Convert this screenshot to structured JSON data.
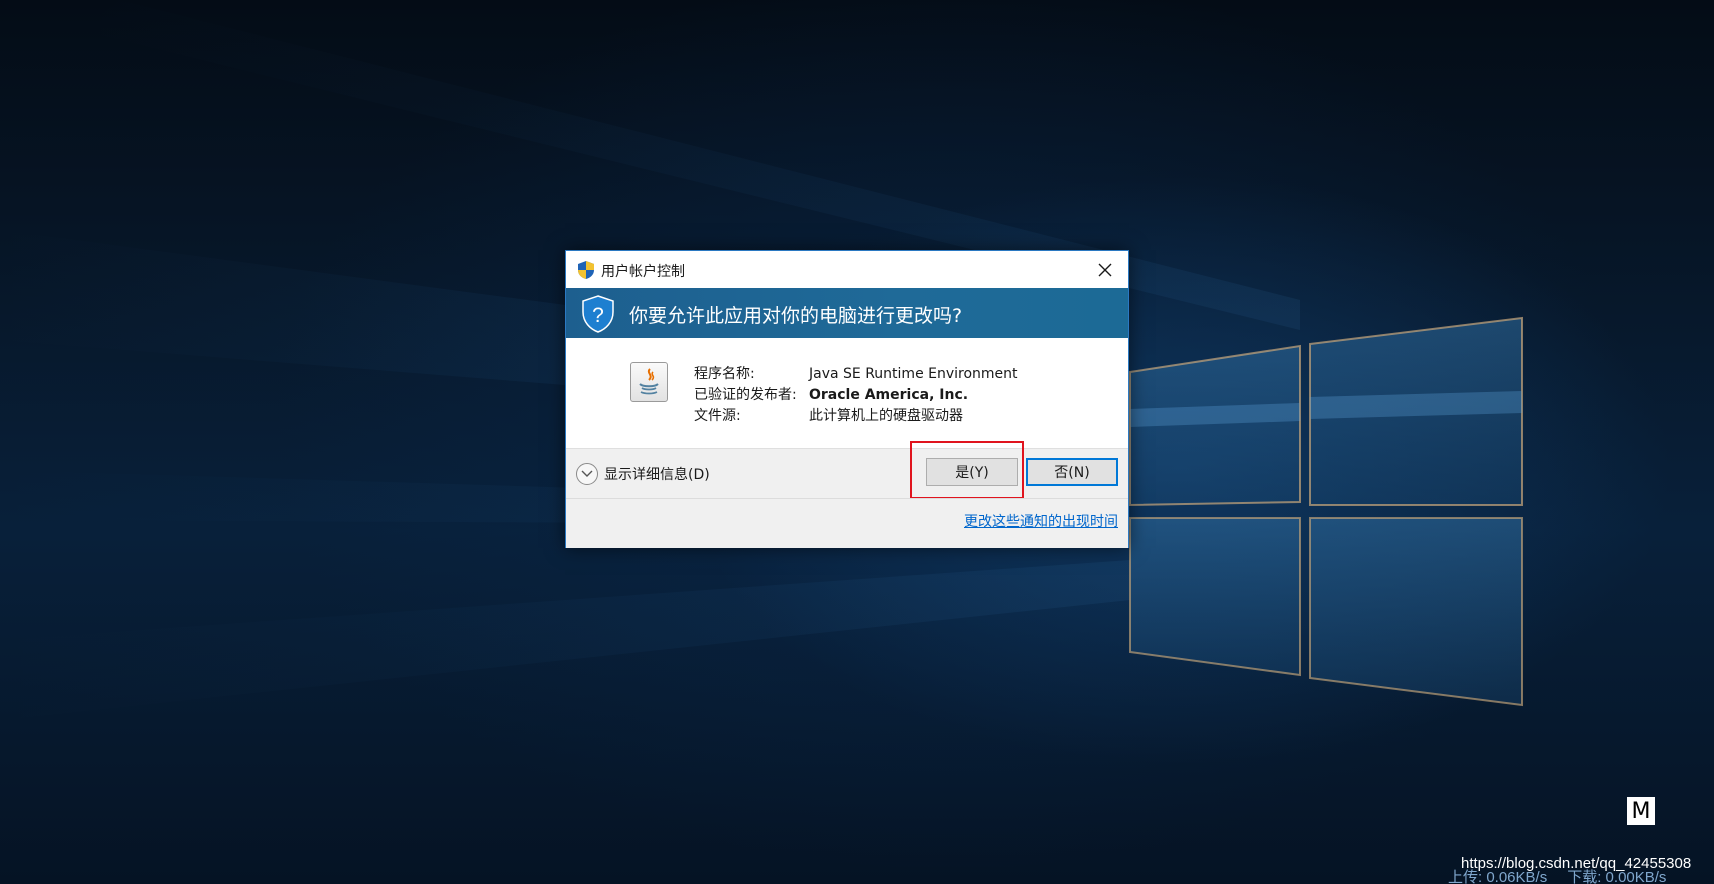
{
  "dialog": {
    "title": "用户帐户控制",
    "question": "你要允许此应用对你的电脑进行更改吗?",
    "app_info": [
      {
        "label": "程序名称:",
        "value": "Java SE Runtime Environment",
        "bold": false
      },
      {
        "label": "已验证的发布者:",
        "value": "Oracle America, Inc.",
        "bold": true
      },
      {
        "label": "文件源:",
        "value": "此计算机上的硬盘驱动器",
        "bold": false
      }
    ],
    "details_label": "显示详细信息(D)",
    "yes_label": "是(Y)",
    "no_label": "否(N)",
    "notify_link": "更改这些通知的出现时间",
    "icons": {
      "title": "uac-shield-icon",
      "banner": "shield-question-icon",
      "app": "java-icon",
      "details": "chevron-down-icon",
      "close": "close-icon"
    },
    "colors": {
      "banner": "#1d5f8f",
      "highlight": "#e0141e",
      "link": "#0066cc",
      "focus": "#0078d7"
    }
  },
  "overlay": {
    "m_badge": "M",
    "watermark": "https://blog.csdn.net/qq_42455308",
    "upload_speed": "上传: 0.06KB/s",
    "download_speed": "下载: 0.00KB/s"
  }
}
